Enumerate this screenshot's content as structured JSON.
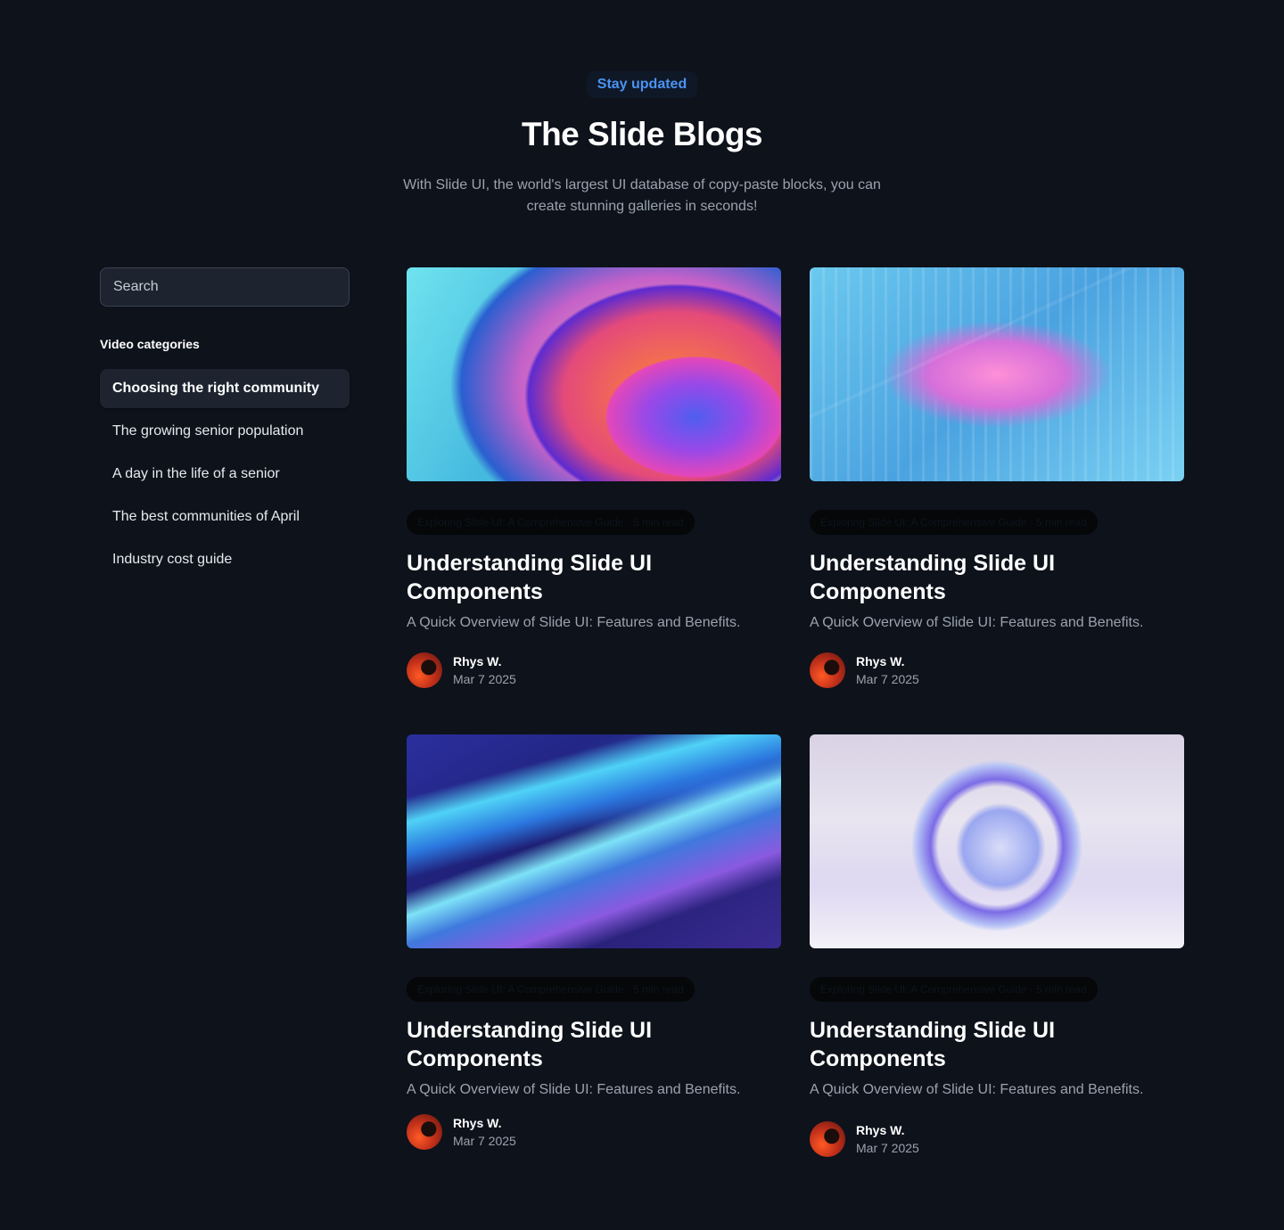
{
  "header": {
    "eyebrow": "Stay updated",
    "title": "The Slide Blogs",
    "subtitle": "With Slide UI, the world's largest UI database of copy-paste blocks, you can create stunning galleries in seconds!"
  },
  "sidebar": {
    "search_placeholder": "Search",
    "categories_heading": "Video categories",
    "categories": [
      {
        "label": "Choosing the right community",
        "active": true
      },
      {
        "label": "The growing senior population",
        "active": false
      },
      {
        "label": "A day in the life of a senior",
        "active": false
      },
      {
        "label": "The best communities of April",
        "active": false
      },
      {
        "label": "Industry cost guide",
        "active": false
      }
    ]
  },
  "cards": [
    {
      "tag": "Exploring Slide UI: A Comprehensive Guide · 5 min read",
      "title": "Understanding Slide UI Components",
      "description": "A Quick Overview of Slide UI: Features and Benefits.",
      "author": "Rhys W.",
      "date": "Mar 7 2025"
    },
    {
      "tag": "Exploring Slide UI: A Comprehensive Guide · 5 min read",
      "title": "Understanding Slide UI Components",
      "description": "A Quick Overview of Slide UI: Features and Benefits.",
      "author": "Rhys W.",
      "date": "Mar 7 2025"
    },
    {
      "tag": "Exploring Slide UI: A Comprehensive Guide · 5 min read",
      "title": "Understanding Slide UI Components",
      "description": "A Quick Overview of Slide UI: Features and Benefits.",
      "author": "Rhys W.",
      "date": "Mar 7 2025"
    },
    {
      "tag": "Exploring Slide UI: A Comprehensive Guide · 5 min read",
      "title": "Understanding Slide UI Components",
      "description": "A Quick Overview of Slide UI: Features and Benefits.",
      "author": "Rhys W.",
      "date": "Mar 7 2025"
    }
  ],
  "colors": {
    "background": "#0d121b",
    "accent": "#4b93f3",
    "muted_text": "#9aa3ae",
    "panel": "#1d2430"
  }
}
